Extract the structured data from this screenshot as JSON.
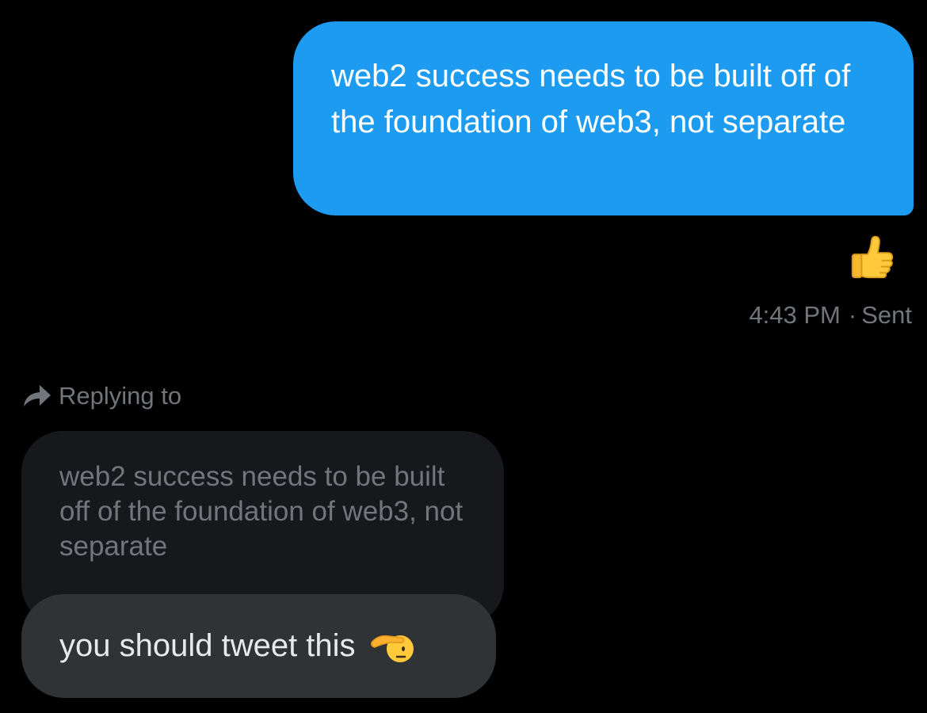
{
  "sent_message": {
    "text": "web2 success needs to be built off of the foundation of web3, not separate",
    "bubble_color": "#1d9bf0",
    "reaction_icon": "thumbs-up-emoji"
  },
  "sent_meta": {
    "time": "4:43 PM",
    "separator": "·",
    "status": "Sent"
  },
  "reply_context": {
    "label": "Replying to",
    "icon": "reply-arrow-icon",
    "quoted_text": "web2 success needs to be built off of the foundation of web3, not separate"
  },
  "received_message": {
    "text": "you should tweet this",
    "emoji_icon": "saluting-face-emoji"
  },
  "colors": {
    "background": "#000000",
    "muted_text": "#71767b",
    "received_bubble": "#2f3336",
    "quoted_bubble": "#16181c"
  }
}
